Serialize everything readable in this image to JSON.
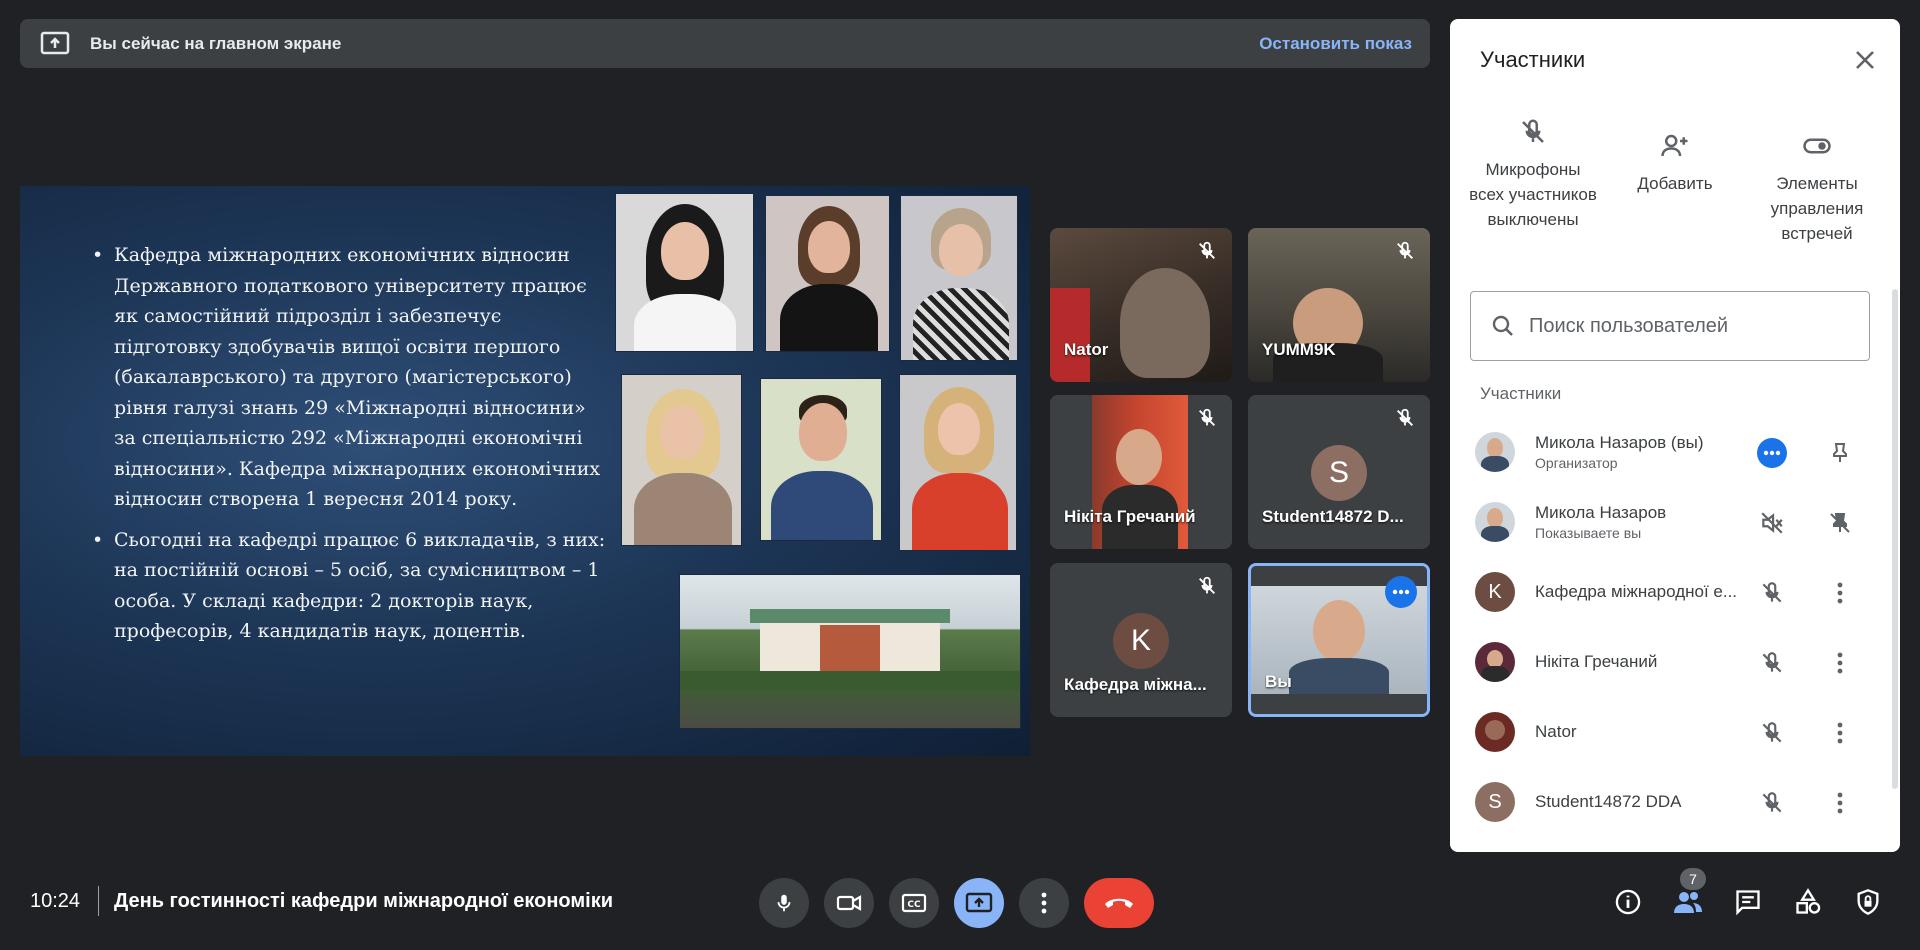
{
  "banner": {
    "text": "Вы сейчас на главном экране",
    "stop_label": "Остановить показ"
  },
  "slide": {
    "bullets": [
      "Кафедра міжнародних економічних відносин Державного податкового університету працює як самостійний підрозділ і забезпечує підготовку здобувачів вищої освіти першого (бакалаврського) та другого (магістерського) рівня галузі знань 29 «Міжнародні відносини» за спеціальністю 292 «Міжнародні економічні відносини». Кафедра міжнародних економічних відносин створена 1 вересня 2014 року.",
      "Сьогодні на кафедрі працює 6 викладачів, з них: на постійній основі – 5 осіб, за сумісництвом – 1 особа. У складі кафедри: 2 докторів наук, професорів, 4 кандидатів наук, доцентів."
    ]
  },
  "tiles": [
    {
      "name": "Nator"
    },
    {
      "name": "YUMM9K"
    },
    {
      "name": "Нікіта Гречаний"
    },
    {
      "name": "Student14872 D...",
      "initial": "S"
    },
    {
      "name": "Кафедра міжна...",
      "initial": "K"
    },
    {
      "name": "Вы"
    }
  ],
  "panel": {
    "title": "Участники",
    "actions": [
      {
        "label": "Микрофоны всех участников выключены",
        "icon": "mic-off-icon"
      },
      {
        "label": "Добавить",
        "icon": "add-person-icon"
      },
      {
        "label": "Элементы управления встречей",
        "icon": "toggle-icon"
      }
    ],
    "search_placeholder": "Поиск пользователей",
    "section_label": "Участники",
    "participants": [
      {
        "name": "Микола Назаров (вы)",
        "sub": "Организатор"
      },
      {
        "name": "Микола Назаров",
        "sub": "Показываете вы"
      },
      {
        "name": "Кафедра міжнародної е...",
        "initial": "K"
      },
      {
        "name": "Нікіта Гречаний"
      },
      {
        "name": "Nator"
      },
      {
        "name": "Student14872 DDA",
        "initial": "S"
      }
    ]
  },
  "bottom": {
    "time": "10:24",
    "meeting_title": "День гостинності кафедри міжнародної економіки",
    "participants_count": "7"
  },
  "colors": {
    "background": "#202124",
    "accent_blue": "#8ab4f8",
    "end_call_red": "#ea4335",
    "avatar_brown": "#8d6e63",
    "avatar_dark": "#6d4c41"
  }
}
